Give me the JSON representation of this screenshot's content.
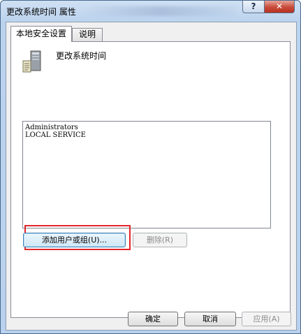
{
  "window": {
    "title": "更改系统时间 属性",
    "help_label": "?",
    "close_label": "✕"
  },
  "tabs": [
    {
      "label": "本地安全设置",
      "active": true
    },
    {
      "label": "说明",
      "active": false
    }
  ],
  "policy": {
    "icon": "computer-tower-icon",
    "name": "更改系统时间"
  },
  "accounts": [
    "Administrators",
    "LOCAL SERVICE"
  ],
  "buttons": {
    "add": "添加用户或组(U)...",
    "remove": "删除(R)",
    "ok": "确定",
    "cancel": "取消",
    "apply": "应用(A)"
  },
  "colors": {
    "highlight": "#e2262a",
    "close_button": "#c74b3a"
  }
}
